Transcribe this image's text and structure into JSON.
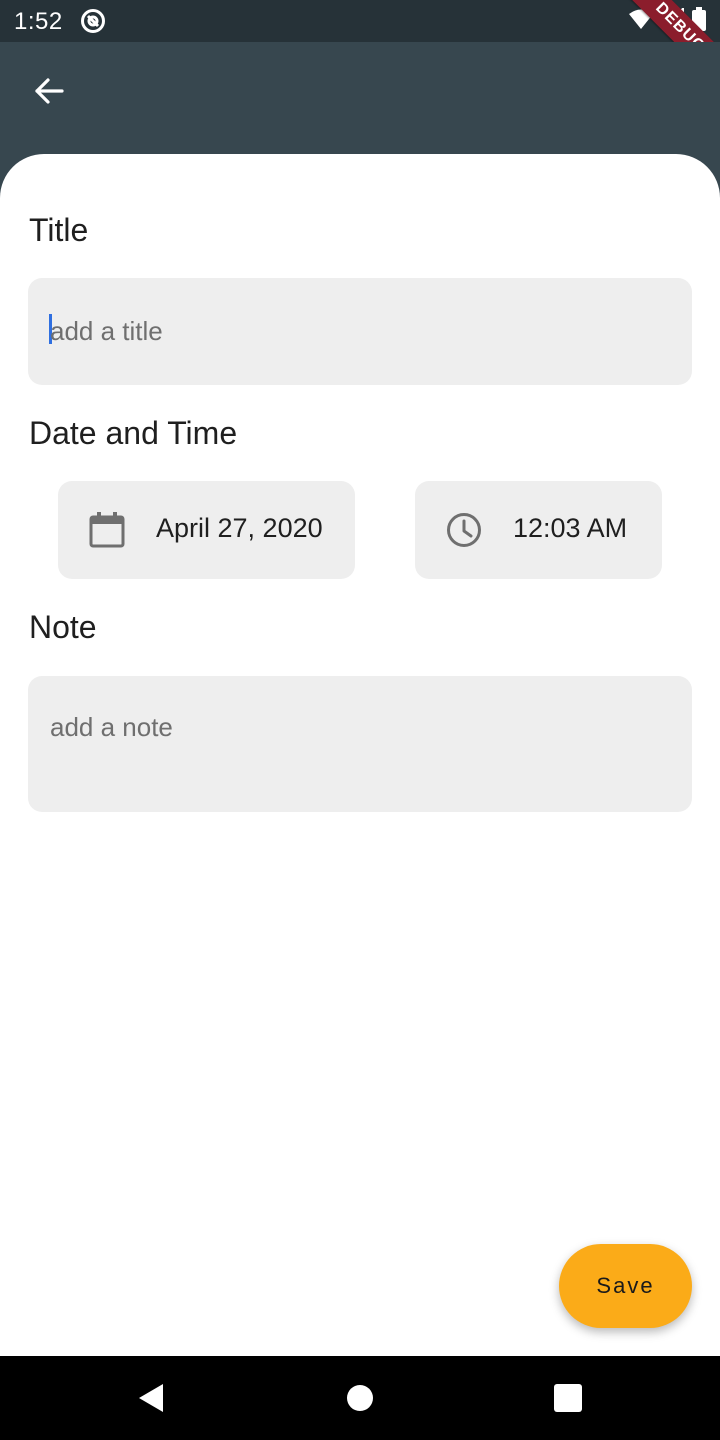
{
  "status_bar": {
    "time": "1:52",
    "debug_banner": "DEBUG",
    "icons": [
      "app-notification-icon",
      "wifi-icon",
      "signal-icon",
      "battery-icon"
    ]
  },
  "app_bar": {
    "back_icon": "arrow-back-icon"
  },
  "form": {
    "title_label": "Title",
    "title_placeholder": "add a title",
    "datetime_label": "Date and Time",
    "date_value": "April 27, 2020",
    "date_icon": "calendar-icon",
    "time_value": "12:03 AM",
    "time_icon": "clock-icon",
    "note_label": "Note",
    "note_placeholder": "add a note"
  },
  "save_button": {
    "label": "Save"
  },
  "nav_bar": {
    "icons": [
      "nav-back-icon",
      "nav-home-icon",
      "nav-recents-icon"
    ]
  },
  "colors": {
    "app_bar": "#37474f",
    "status_bar": "#263238",
    "accent": "#fbab18",
    "field_bg": "#eeeeee",
    "caret": "#2f6fe0"
  }
}
